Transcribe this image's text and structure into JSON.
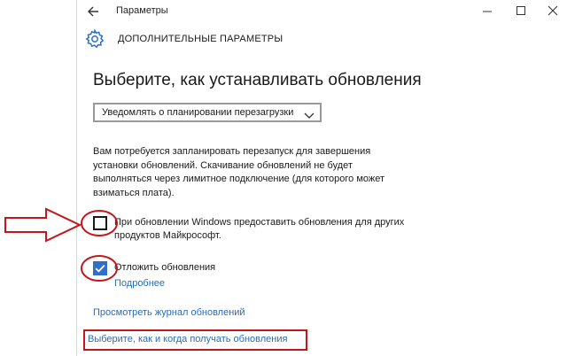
{
  "window": {
    "title": "Параметры",
    "back_icon": "back-arrow-icon",
    "controls": [
      "minimize-icon",
      "maximize-icon",
      "close-icon"
    ]
  },
  "header": {
    "icon": "gear-icon",
    "title": "ДОПОЛНИТЕЛЬНЫЕ ПАРАМЕТРЫ"
  },
  "main": {
    "section_title": "Выберите, как устанавливать обновления",
    "dropdown": {
      "selected": "Уведомлять о планировании перезагрузки"
    },
    "description": "Вам потребуется запланировать перезапуск для завершения установки обновлений. Скачивание обновлений не будет выполняться через лимитное подключение (для которого может взиматься плата).",
    "checkboxes": [
      {
        "label": "При обновлении Windows предоставить обновления для других продуктов Майкрософт.",
        "checked": false
      },
      {
        "label": "Отложить обновления",
        "checked": true,
        "link": "Подробнее"
      }
    ],
    "links": {
      "history": "Просмотреть журнал обновлений",
      "how_when": "Выберите, как и когда получать обновления"
    }
  },
  "colors": {
    "accent": "#2f6fc7",
    "link": "#2a6cb8",
    "annotation": "#c4161c"
  }
}
